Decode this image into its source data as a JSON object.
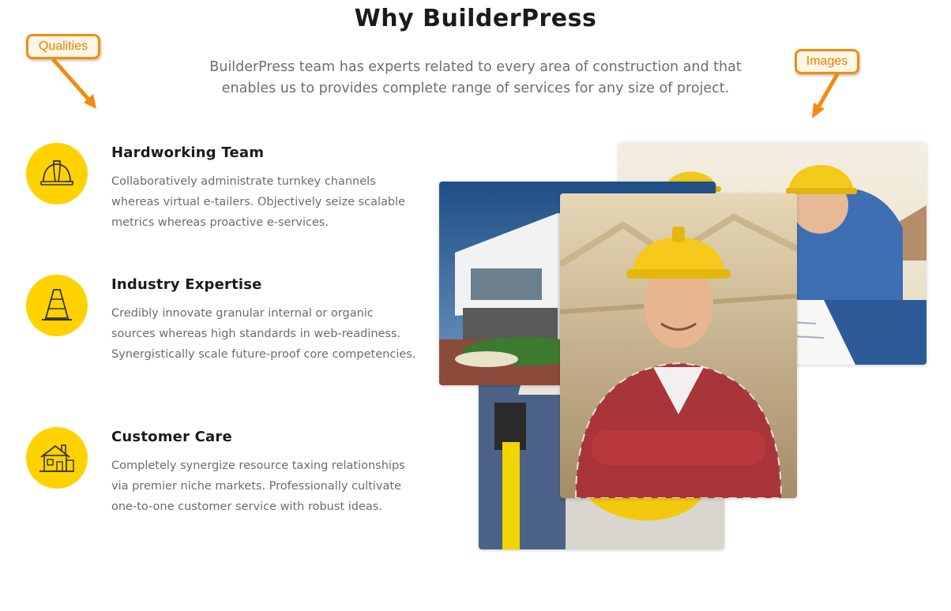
{
  "header": {
    "title": "Why BuilderPress",
    "intro": "BuilderPress team has experts related to every area of construction and that enables us to provides complete range of services for any size of project."
  },
  "callouts": {
    "qualities": "Qualities",
    "images": "Images"
  },
  "features": [
    {
      "title": "Hardworking Team",
      "text": "Collaboratively administrate turnkey channels whereas virtual e-tailers. Objectively seize scalable metrics whereas proactive e-services.",
      "icon": "hard-hat-icon"
    },
    {
      "title": "Industry Expertise",
      "text": "Credibly innovate granular internal or organic sources whereas high standards in web-readiness. Synergistically scale future-proof core competencies.",
      "icon": "traffic-cone-icon"
    },
    {
      "title": "Customer Care",
      "text": "Completely synergize resource taxing relationships via premier niche markets. Professionally cultivate one-to-one customer service with robust ideas.",
      "icon": "house-icon"
    }
  ],
  "colors": {
    "accent": "#ffd200",
    "callout": "#f28c0f",
    "heading": "#1b1b1b",
    "body": "#6c6c6c"
  }
}
